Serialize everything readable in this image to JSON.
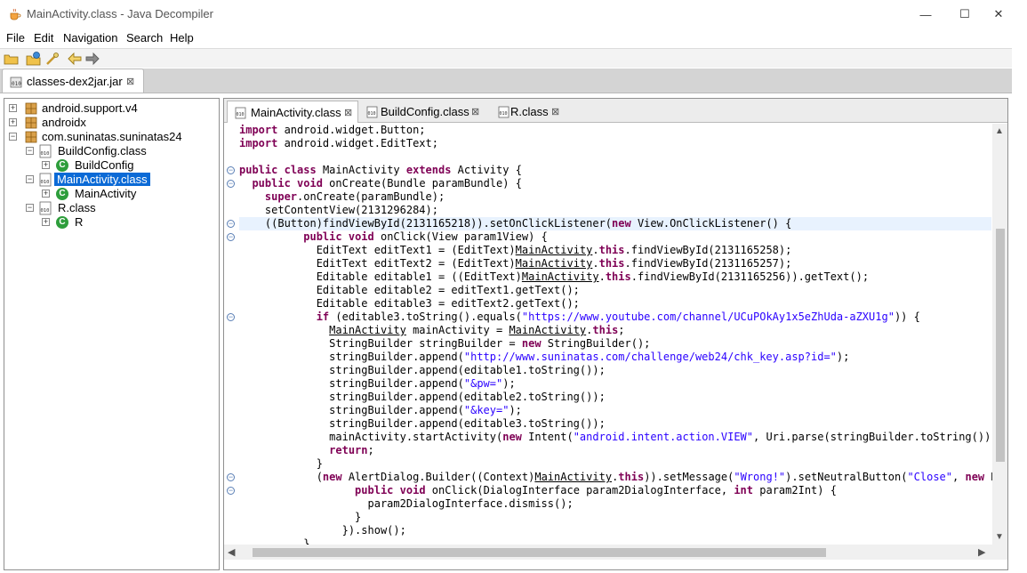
{
  "window": {
    "title": "MainActivity.class - Java Decompiler",
    "minimize_label": "—",
    "maximize_label": "☐",
    "close_label": "✕"
  },
  "menu": [
    "File",
    "Edit",
    "Navigation",
    "Search",
    "Help"
  ],
  "toolbar": {
    "icons": [
      "open-file-icon",
      "open-type-icon",
      "search-icon",
      "back-icon",
      "forward-icon"
    ]
  },
  "file_tab": {
    "label": "classes-dex2jar.jar",
    "close": "⊠"
  },
  "tree": {
    "items": [
      {
        "label": "android.support.v4",
        "expander": "+"
      },
      {
        "label": "androidx",
        "expander": "+"
      },
      {
        "label": "com.suninatas.suninatas24",
        "expander": "−"
      },
      {
        "label": "BuildConfig.class",
        "expander": "−"
      },
      {
        "label": "BuildConfig",
        "expander": "+"
      },
      {
        "label": "MainActivity.class",
        "expander": "−"
      },
      {
        "label": "MainActivity",
        "expander": "+"
      },
      {
        "label": "R.class",
        "expander": "−"
      },
      {
        "label": "R",
        "expander": "+"
      }
    ],
    "selected_index": 5
  },
  "editor_tabs": [
    {
      "label": "MainActivity.class",
      "close": "⊠",
      "active": true
    },
    {
      "label": "BuildConfig.class",
      "close": "⊠",
      "active": false
    },
    {
      "label": "R.class",
      "close": "⊠",
      "active": false
    }
  ],
  "code_lines": [
    "import android.widget.Button;",
    "import android.widget.EditText;",
    "",
    "public class MainActivity extends Activity {",
    "  public void onCreate(Bundle paramBundle) {",
    "    super.onCreate(paramBundle);",
    "    setContentView(2131296284);",
    "    ((Button)findViewById(2131165218)).setOnClickListener(new View.OnClickListener() {",
    "          public void onClick(View param1View) {",
    "            EditText editText1 = (EditText)MainActivity.this.findViewById(2131165258);",
    "            EditText editText2 = (EditText)MainActivity.this.findViewById(2131165257);",
    "            Editable editable1 = ((EditText)MainActivity.this.findViewById(2131165256)).getText();",
    "            Editable editable2 = editText1.getText();",
    "            Editable editable3 = editText2.getText();",
    "            if (editable3.toString().equals(\"https://www.youtube.com/channel/UCuPOkAy1x5eZhUda-aZXU1g\")) {",
    "              MainActivity mainActivity = MainActivity.this;",
    "              StringBuilder stringBuilder = new StringBuilder();",
    "              stringBuilder.append(\"http://www.suninatas.com/challenge/web24/chk_key.asp?id=\");",
    "              stringBuilder.append(editable1.toString());",
    "              stringBuilder.append(\"&pw=\");",
    "              stringBuilder.append(editable2.toString());",
    "              stringBuilder.append(\"&key=\");",
    "              stringBuilder.append(editable3.toString());",
    "              mainActivity.startActivity(new Intent(\"android.intent.action.VIEW\", Uri.parse(stringBuilder.toString())));",
    "              return;",
    "            }",
    "            (new AlertDialog.Builder((Context)MainActivity.this)).setMessage(\"Wrong!\").setNeutralButton(\"Close\", new Dial",
    "                  public void onClick(DialogInterface param2DialogInterface, int param2Int) {",
    "                    param2DialogInterface.dismiss();",
    "                  }",
    "                }).show();",
    "          }"
  ],
  "fold_lines": [
    3,
    4,
    7,
    8,
    14,
    26,
    27
  ],
  "highlight_line": 7,
  "scroll": {
    "up": "▲",
    "down": "▼",
    "left": "◀",
    "right": "▶"
  }
}
